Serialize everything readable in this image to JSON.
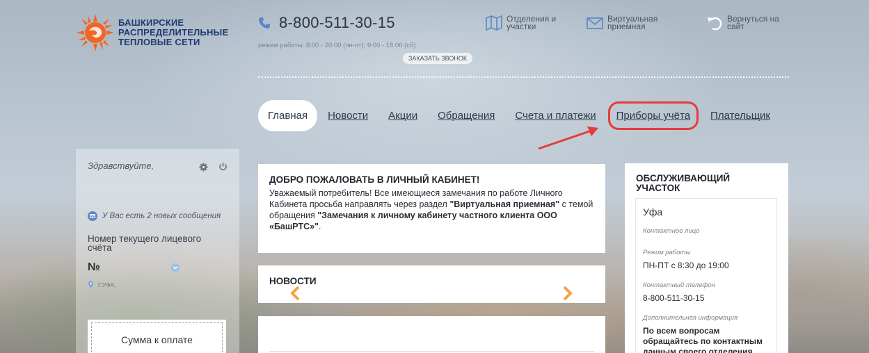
{
  "brand": {
    "name_lines": [
      "БАШКИРСКИЕ",
      "РАСПРЕДЕЛИТЕЛЬНЫЕ",
      "ТЕПЛОВЫЕ СЕТИ"
    ],
    "logo_icon": "sun-logo-icon",
    "logo_color": "#f26522"
  },
  "contact": {
    "phone": "8-800-511-30-15",
    "hours": "режим работы: 8:00 - 20:00 (пн-пт); 9:00 - 18:00 (сб)",
    "callback_label": "ЗАКАЗАТЬ ЗВОНОК"
  },
  "top_links": {
    "branches": "Отделения и участки",
    "reception": "Виртуальная приемная",
    "back": "Вернуться на сайт"
  },
  "nav": {
    "items": [
      "Главная",
      "Новости",
      "Акции",
      "Обращения",
      "Счета и платежи",
      "Приборы учёта",
      "Плательщик"
    ],
    "active_index": 0,
    "highlighted_index": 5,
    "highlight_color": "#e53b3b"
  },
  "sidebar": {
    "greeting": "Здравствуйте,",
    "messages": "У Вас есть 2 новых сообщения",
    "account_label": "Номер текущего лицевого счёта",
    "account_no": "№",
    "city": "Г.УФА,",
    "sum_label": "Сумма к оплате"
  },
  "welcome": {
    "title": "ДОБРО ПОЖАЛОВАТЬ В ЛИЧНЫЙ КАБИНЕТ!",
    "text_1": "Уважаемый потребитель! Все имеющиеся замечания по работе Личного Кабинета просьба направлять через раздел ",
    "link_1": "\"Виртуальная приемная\"",
    "text_2": " с темой обращения ",
    "link_2": "\"Замечания к личному кабинету частного клиента ООО «БашРТС»\"",
    "text_3": "."
  },
  "news": {
    "title": "НОВОСТИ"
  },
  "district": {
    "title": "ОБСЛУЖИВАЮЩИЙ УЧАСТОК",
    "city": "Уфа",
    "contact_label": "Контактное лицо",
    "hours_label": "Режим работы",
    "hours_value": "ПН-ПТ с 8:30 до 19:00",
    "phone_label": "Контактный телефон",
    "phone_value": "8-800-511-30-15",
    "info_label": "Дополнительная информация",
    "info_value": "По всем вопросам обращайтесь по контактным данным своего отделения."
  },
  "colors": {
    "accent_orange": "#f5a04a",
    "icon_blue": "#5b86c6"
  }
}
